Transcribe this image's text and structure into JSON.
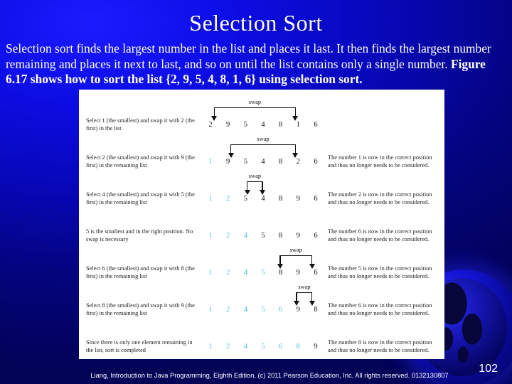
{
  "slide": {
    "title": "Selection Sort",
    "body_lead": "Selection sort finds the largest number in the list and places it last. It then finds the largest number remaining and places it next to last, and so on until the list contains only a single number. ",
    "body_bold": "Figure 6.17 shows how to sort the list {2, 9, 5, 4, 8, 1, 6} using selection sort.",
    "accent_color": "#4fc3dc",
    "background_color": "#0707b8"
  },
  "figure": {
    "swap_label": "swap",
    "rows": [
      {
        "description": "Select 1 (the smallest) and swap it with 2 (the first) in the list",
        "numbers": [
          "2",
          "9",
          "5",
          "4",
          "8",
          "1",
          "6"
        ],
        "sorted_count": 0,
        "note": "",
        "swap": {
          "from": 0,
          "to": 5
        }
      },
      {
        "description": "Select 2 (the smallest) and swap it with 9 (the first) in the remaining list",
        "numbers": [
          "1",
          "9",
          "5",
          "4",
          "8",
          "2",
          "6"
        ],
        "sorted_count": 1,
        "note": "The number 1 is now in the correct position and thus no longer needs to be considered.",
        "swap": {
          "from": 1,
          "to": 5
        }
      },
      {
        "description": "Select 4 (the smallest) and swap it with 5 (the first) in the remaining list",
        "numbers": [
          "1",
          "2",
          "5",
          "4",
          "8",
          "9",
          "6"
        ],
        "sorted_count": 2,
        "note": "The number 2 is now in the correct position and thus no longer needs to be considered.",
        "swap": {
          "from": 2,
          "to": 3
        }
      },
      {
        "description": "5 is the smallest and in the right position. No swap is necessary",
        "numbers": [
          "1",
          "2",
          "4",
          "5",
          "8",
          "9",
          "6"
        ],
        "sorted_count": 3,
        "note": "The number 6 is now in the correct position and thus no longer needs to be considered.",
        "swap": null
      },
      {
        "description": "Select 6 (the smallest) and swap it with 8 (the first) in the remaining list",
        "numbers": [
          "1",
          "2",
          "4",
          "5",
          "8",
          "9",
          "6"
        ],
        "sorted_count": 4,
        "note": "The number 5 is now in the correct position and thus no longer needs to be considered.",
        "swap": {
          "from": 4,
          "to": 6
        }
      },
      {
        "description": "Select 8 (the smallest) and swap it with 9 (the first) in the remaining list",
        "numbers": [
          "1",
          "2",
          "4",
          "5",
          "6",
          "9",
          "8"
        ],
        "sorted_count": 5,
        "note": "The number 6 is now in the correct position and thus no longer needs to be considered.",
        "swap": {
          "from": 5,
          "to": 6
        }
      },
      {
        "description": "Since there is only one element remaining in the list, sort is completed",
        "numbers": [
          "1",
          "2",
          "4",
          "5",
          "6",
          "8",
          "9"
        ],
        "sorted_count": 6,
        "note": "The number 8 is now in the correct position and thus no longer needs to be considered.",
        "swap": null
      }
    ]
  },
  "footer": {
    "credit": "Liang, Introduction to Java Programming, Eighth Edition, (c) 2011 Pearson Education, Inc. All rights reserved. 0132130807",
    "page_number": "102"
  }
}
